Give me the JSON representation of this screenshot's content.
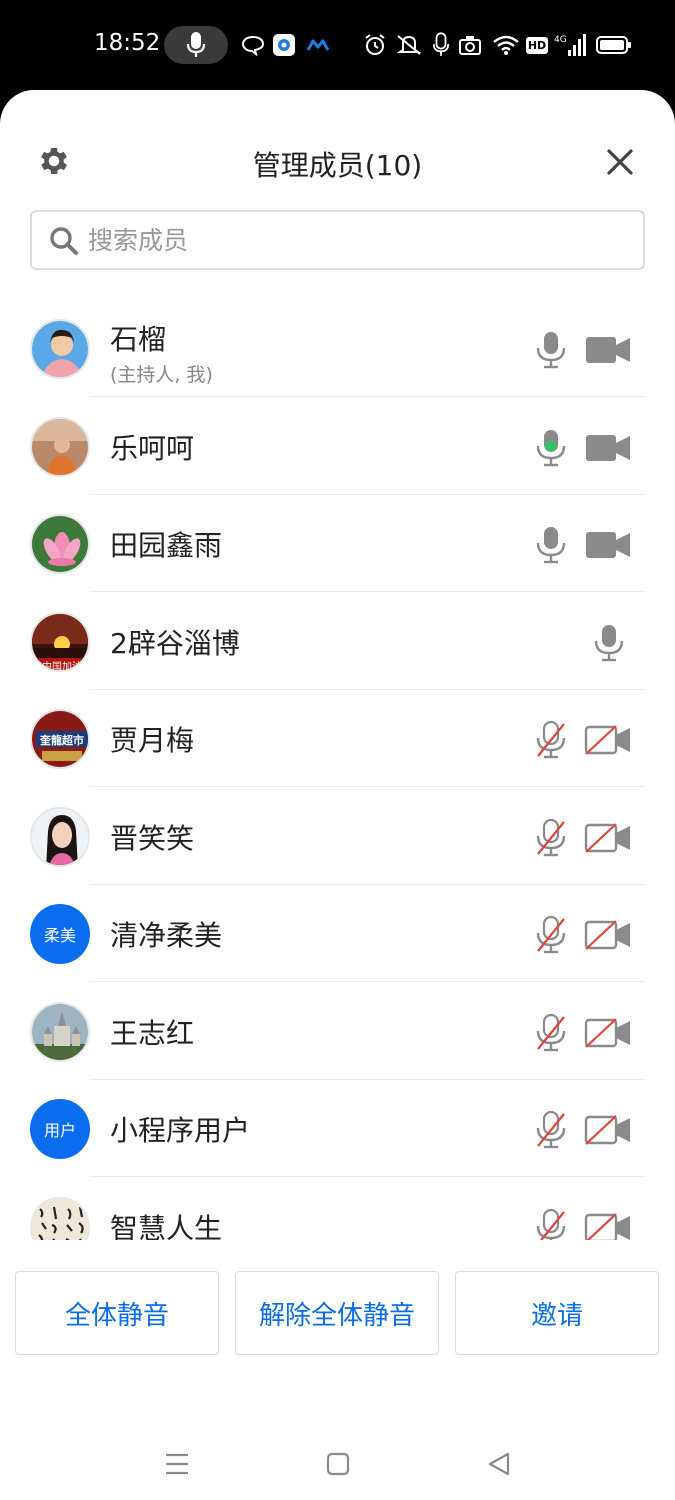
{
  "status_bar": {
    "time": "18:52",
    "icons": [
      "mic-icon",
      "chat-bubble-icon",
      "app-icon",
      "assistant-icon",
      "alarm-icon",
      "mute-icon",
      "mic-icon",
      "camera-icon",
      "wifi-icon",
      "hd-icon",
      "signal-4g-icon",
      "battery-icon"
    ],
    "hd_label": "HD",
    "network_label": "4G"
  },
  "header": {
    "title": "管理成员(10)",
    "settings_icon": "gear-icon",
    "close_icon": "close-icon"
  },
  "search": {
    "placeholder": "搜索成员",
    "value": ""
  },
  "members": [
    {
      "name": "石榴",
      "role": "(主持人, 我)",
      "mic": "on",
      "camera": "on",
      "avatar": "photo-portrait"
    },
    {
      "name": "乐呵呵",
      "role": "",
      "mic": "speaking",
      "camera": "on",
      "avatar": "photo-person"
    },
    {
      "name": "田园鑫雨",
      "role": "",
      "mic": "on",
      "camera": "on",
      "avatar": "photo-lotus"
    },
    {
      "name": "2辟谷淄博",
      "role": "",
      "mic": "on",
      "camera": "none",
      "avatar": "photo-sunset",
      "avatar_text": "中国加油"
    },
    {
      "name": "贾月梅",
      "role": "",
      "mic": "muted",
      "camera": "off",
      "avatar": "photo-store",
      "avatar_text": "奎龍超市"
    },
    {
      "name": "晋笑笑",
      "role": "",
      "mic": "muted",
      "camera": "off",
      "avatar": "photo-woman"
    },
    {
      "name": "清净柔美",
      "role": "",
      "mic": "muted",
      "camera": "off",
      "avatar": "text",
      "avatar_text": "柔美"
    },
    {
      "name": "王志红",
      "role": "",
      "mic": "muted",
      "camera": "off",
      "avatar": "photo-castle"
    },
    {
      "name": "小程序用户",
      "role": "",
      "mic": "muted",
      "camera": "off",
      "avatar": "text",
      "avatar_text": "用户"
    },
    {
      "name": "智慧人生",
      "role": "",
      "mic": "muted",
      "camera": "off",
      "avatar": "photo-calligraphy"
    }
  ],
  "footer": {
    "mute_all": "全体静音",
    "unmute_all": "解除全体静音",
    "invite": "邀请"
  },
  "colors": {
    "accent": "#0a6df0",
    "icon_gray": "#8a8a8a",
    "muted_red": "#e0443a",
    "speaking_green": "#33c26a"
  }
}
